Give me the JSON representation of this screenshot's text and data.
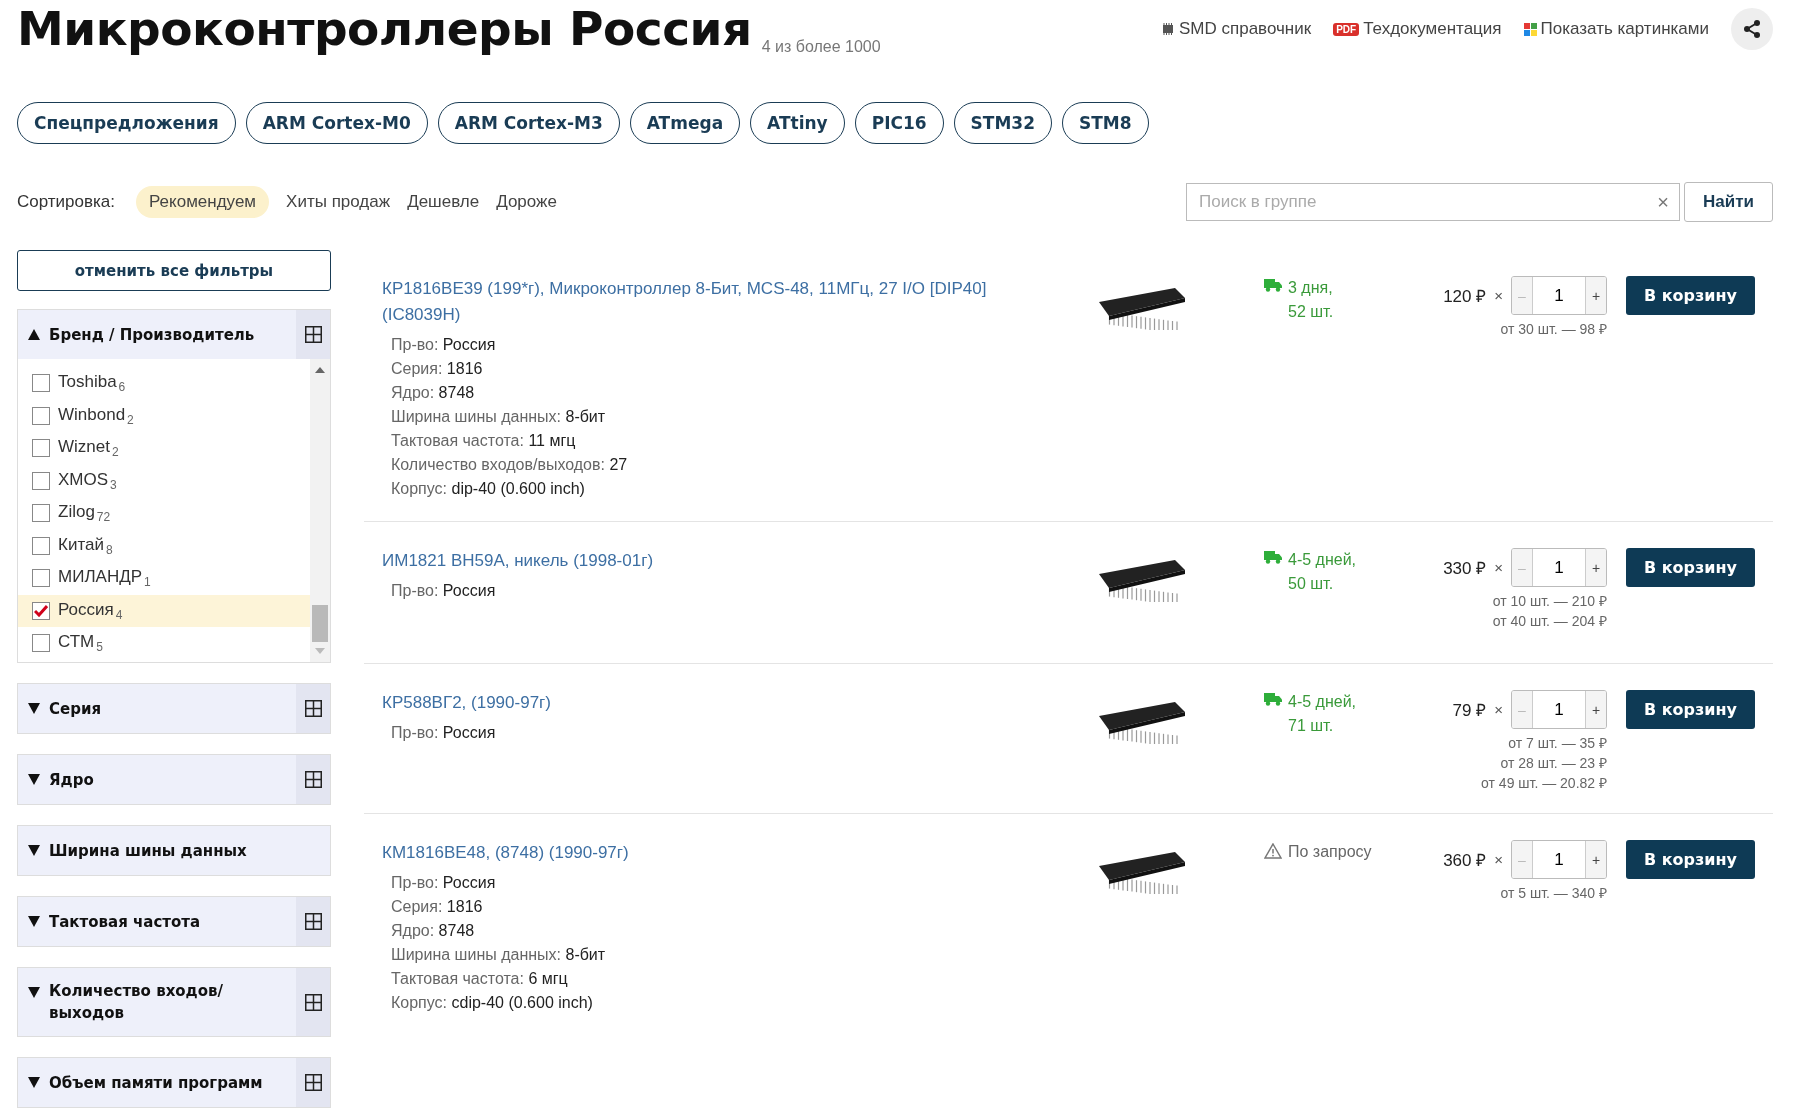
{
  "title": "Микроконтроллеры Россия",
  "count": "4 из более 1000",
  "header_links": [
    {
      "kind": "chip",
      "label": "SMD справочник"
    },
    {
      "kind": "pdf",
      "badge": "PDF",
      "label": "Техдокументация"
    },
    {
      "kind": "tiles",
      "label": "Показать картинками"
    }
  ],
  "categories": [
    "Спецпредложения",
    "ARM Cortex-M0",
    "ARM Cortex-M3",
    "ATmega",
    "ATtiny",
    "PIC16",
    "STM32",
    "STM8"
  ],
  "sort": {
    "label": "Сортировка:",
    "options": [
      {
        "label": "Рекомендуем",
        "selected": true
      },
      {
        "label": "Хиты продаж",
        "selected": false
      },
      {
        "label": "Дешевле",
        "selected": false
      },
      {
        "label": "Дороже",
        "selected": false
      }
    ]
  },
  "search": {
    "placeholder": "Поиск в группе",
    "clear": "×",
    "button": "Найти"
  },
  "reset_filters": "отменить все фильтры",
  "filters": [
    {
      "title": "Бренд / Производитель",
      "expanded": true,
      "grid_toggle": true,
      "options": [
        {
          "name": "Toshiba",
          "count": "6",
          "checked": false
        },
        {
          "name": "Winbond",
          "count": "2",
          "checked": false
        },
        {
          "name": "Wiznet",
          "count": "2",
          "checked": false
        },
        {
          "name": "XMOS",
          "count": "3",
          "checked": false
        },
        {
          "name": "Zilog",
          "count": "72",
          "checked": false
        },
        {
          "name": "Китай",
          "count": "8",
          "checked": false
        },
        {
          "name": "МИЛАНДР",
          "count": "1",
          "checked": false
        },
        {
          "name": "Россия",
          "count": "4",
          "checked": true
        },
        {
          "name": "СТМ",
          "count": "5",
          "checked": false
        }
      ]
    },
    {
      "title": "Серия",
      "expanded": false,
      "grid_toggle": true
    },
    {
      "title": "Ядро",
      "expanded": false,
      "grid_toggle": true
    },
    {
      "title": "Ширина шины данных",
      "expanded": false,
      "grid_toggle": false
    },
    {
      "title": "Тактовая частота",
      "expanded": false,
      "grid_toggle": true
    },
    {
      "title": "Количество входов/ выходов",
      "expanded": false,
      "grid_toggle": true
    },
    {
      "title": "Объем памяти программ",
      "expanded": false,
      "grid_toggle": true
    }
  ],
  "products": [
    {
      "title": "КР1816ВЕ39 (199*г), Микроконтроллер 8-Бит, MCS-48, 11МГц, 27 I/O [DIP40] (IC8039H)",
      "specs": [
        {
          "label": "Пр-во:",
          "value": "Россия"
        },
        {
          "label": "Серия:",
          "value": "1816"
        },
        {
          "label": "Ядро:",
          "value": "8748"
        },
        {
          "label": "Ширина шины данных:",
          "value": "8-бит"
        },
        {
          "label": "Тактовая частота:",
          "value": "11 мгц"
        },
        {
          "label": "Количество входов/выходов:",
          "value": "27"
        },
        {
          "label": "Корпус:",
          "value": "dip-40 (0.600 inch)"
        }
      ],
      "delivery": {
        "kind": "stock",
        "lines": [
          "3 дня,",
          "52 шт."
        ]
      },
      "price": "120 ₽",
      "times": "×",
      "minus": "–",
      "quantity": "1",
      "plus": "+",
      "tiers": [
        "от 30 шт. — 98 ₽"
      ],
      "button": "В корзину"
    },
    {
      "title": "ИМ1821 ВН59А, никель (1998-01г)",
      "specs": [
        {
          "label": "Пр-во:",
          "value": "Россия"
        }
      ],
      "delivery": {
        "kind": "stock",
        "lines": [
          "4-5 дней,",
          "50 шт."
        ]
      },
      "price": "330 ₽",
      "times": "×",
      "minus": "–",
      "quantity": "1",
      "plus": "+",
      "tiers": [
        "от 10 шт. — 210 ₽",
        "от 40 шт. — 204 ₽"
      ],
      "button": "В корзину"
    },
    {
      "title": "КР588ВГ2, (1990-97г)",
      "specs": [
        {
          "label": "Пр-во:",
          "value": "Россия"
        }
      ],
      "delivery": {
        "kind": "stock",
        "lines": [
          "4-5 дней,",
          "71 шт."
        ]
      },
      "price": "79 ₽",
      "times": "×",
      "minus": "–",
      "quantity": "1",
      "plus": "+",
      "tiers": [
        "от 7 шт. — 35 ₽",
        "от 28 шт. — 23 ₽",
        "от 49 шт. — 20.82 ₽"
      ],
      "button": "В корзину"
    },
    {
      "title": "КМ1816ВЕ48, (8748) (1990-97г)",
      "specs": [
        {
          "label": "Пр-во:",
          "value": "Россия"
        },
        {
          "label": "Серия:",
          "value": "1816"
        },
        {
          "label": "Ядро:",
          "value": "8748"
        },
        {
          "label": "Ширина шины данных:",
          "value": "8-бит"
        },
        {
          "label": "Тактовая частота:",
          "value": "6 мгц"
        },
        {
          "label": "Корпус:",
          "value": "cdip-40 (0.600 inch)"
        }
      ],
      "delivery": {
        "kind": "request",
        "lines": [
          "По запросу"
        ]
      },
      "price": "360 ₽",
      "times": "×",
      "minus": "–",
      "quantity": "1",
      "plus": "+",
      "tiers": [
        "от 5 шт. — 340 ₽"
      ],
      "button": "В корзину"
    }
  ]
}
